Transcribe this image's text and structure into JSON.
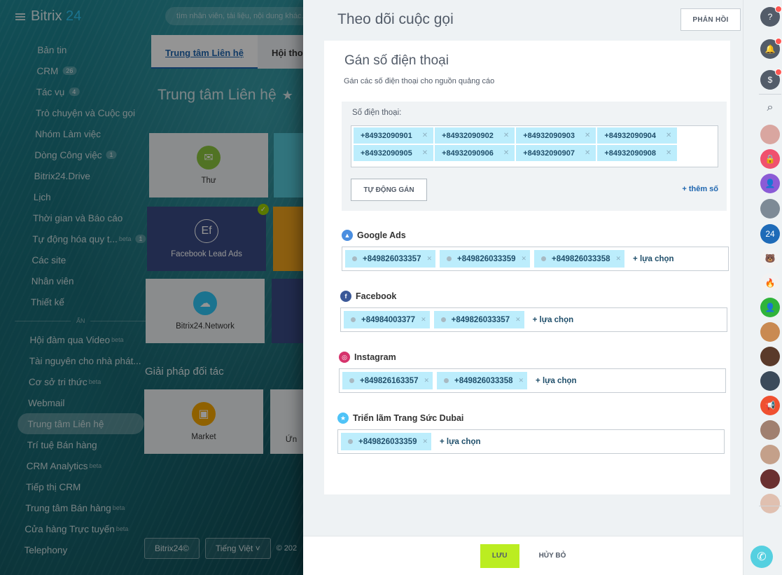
{
  "app": {
    "logo_main": "Bitrix",
    "logo_num": "24",
    "search_placeholder": "tìm nhân viên, tài liệu, nội dung khác..."
  },
  "sidebar": {
    "items": [
      {
        "label": "Bản tin"
      },
      {
        "label": "CRM",
        "count": "26"
      },
      {
        "label": "Tác vụ",
        "count": "4"
      },
      {
        "label": "Trò chuyện và Cuộc gọi"
      },
      {
        "label": "Nhóm Làm việc"
      },
      {
        "label": "Dòng Công việc",
        "count": "1"
      },
      {
        "label": "Bitrix24.Drive"
      },
      {
        "label": "Lịch"
      },
      {
        "label": "Thời gian và Báo cáo"
      },
      {
        "label": "Tự động hóa quy t...",
        "beta": "beta",
        "count": "1"
      },
      {
        "label": "Các site"
      },
      {
        "label": "Nhân viên"
      },
      {
        "label": "Thiết kế"
      }
    ],
    "hidden_label": "ẨN",
    "hidden_items": [
      {
        "label": "Hội đàm qua Video",
        "beta": "beta"
      },
      {
        "label": "Tài nguyên cho nhà phát..."
      },
      {
        "label": "Cơ sở tri thức",
        "beta": "beta"
      },
      {
        "label": "Webmail"
      },
      {
        "label": "Trung tâm Liên hệ",
        "active": true
      },
      {
        "label": "Trí tuệ Bán hàng"
      },
      {
        "label": "CRM Analytics",
        "beta": "beta"
      },
      {
        "label": "Tiếp thị CRM"
      },
      {
        "label": "Trung tâm Bán hàng",
        "beta": "beta"
      },
      {
        "label": "Cửa hàng Trực tuyến",
        "beta": "beta"
      },
      {
        "label": "Telephony"
      }
    ]
  },
  "background_page": {
    "tabs": [
      "Trung tâm Liên hệ",
      "Hội thoại"
    ],
    "title": "Trung tâm Liên hệ",
    "tiles": [
      {
        "label": "Thư",
        "icon": "mail-icon"
      },
      {
        "label": "Facebook Lead Ads",
        "icon": "form-icon"
      },
      {
        "label": "Bitrix24.Network",
        "icon": "cloud-icon"
      }
    ],
    "partner_title": "Giải pháp đối tác",
    "partner_tiles": [
      {
        "label": "Market"
      },
      {
        "label": "Ứn"
      }
    ],
    "footer": {
      "brand": "Bitrix24©",
      "language": "Tiếng Việt",
      "copyright": "© 202"
    }
  },
  "slider": {
    "title": "Theo dõi cuộc gọi",
    "feedback_label": "PHẢN HỒI",
    "card": {
      "title": "Gán số điện thoại",
      "subtitle": "Gán các số điện thoại cho nguồn quảng cáo",
      "phones_label": "Số điện thoại:",
      "phones": [
        "+84932090901",
        "+84932090902",
        "+84932090903",
        "+84932090904",
        "+84932090905",
        "+84932090906",
        "+84932090907",
        "+84932090908"
      ],
      "auto_assign_label": "TỰ ĐỘNG GÁN",
      "add_number_label": "+ thêm số"
    },
    "add_choice_label": "+ lựa chọn",
    "sources": [
      {
        "name": "Google Ads",
        "icon": "google-ads-icon",
        "color": "#4a8ee0",
        "glyph": "▲",
        "numbers": [
          "+849826033357",
          "+849826033359",
          "+849826033358"
        ]
      },
      {
        "name": "Facebook",
        "icon": "facebook-icon",
        "color": "#3b5998",
        "glyph": "f",
        "numbers": [
          "+84984003377",
          "+849826033357"
        ]
      },
      {
        "name": "Instagram",
        "icon": "instagram-icon",
        "color": "#d6336c",
        "glyph": "◎",
        "numbers": [
          "+849826163357",
          "+849826033358"
        ]
      },
      {
        "name": "Triển lãm Trang Sức Dubai",
        "icon": "star-icon",
        "color": "#4fc3f7",
        "glyph": "★",
        "numbers": [
          "+849826033359"
        ]
      }
    ],
    "footer": {
      "save_label": "LƯU",
      "cancel_label": "HỦY BỎ"
    }
  },
  "rail": {
    "items": [
      {
        "icon": "help-icon",
        "glyph": "?",
        "color": "#535c69",
        "badge": true
      },
      {
        "icon": "bell-icon",
        "glyph": "🔔",
        "color": "#535c69",
        "badge": true
      },
      {
        "icon": "chat-count-icon",
        "glyph": "$",
        "color": "#535c69",
        "badge": true
      },
      {
        "icon": "search-icon",
        "glyph": "⌕",
        "color": "transparent"
      },
      {
        "icon": "avatar-icon",
        "glyph": "",
        "color": "#d9a6a0"
      },
      {
        "icon": "lock-icon",
        "glyph": "🔒",
        "color": "#f0506e"
      },
      {
        "icon": "user-icon",
        "glyph": "👤",
        "color": "#8b5bd6"
      },
      {
        "icon": "avatar-icon",
        "glyph": "",
        "color": "#7d8a96"
      },
      {
        "icon": "bitrix24-icon",
        "glyph": "24",
        "color": "#1e6bb8"
      },
      {
        "icon": "mascot-icon",
        "glyph": "🐻",
        "color": "#f2f2f2"
      },
      {
        "icon": "flame-icon",
        "glyph": "🔥",
        "color": "#f2f2f2"
      },
      {
        "icon": "crm-user-icon",
        "glyph": "👤",
        "color": "#2fb43a"
      },
      {
        "icon": "avatar-icon",
        "glyph": "",
        "color": "#c98a52"
      },
      {
        "icon": "avatar-icon",
        "glyph": "",
        "color": "#5a3a2a"
      },
      {
        "icon": "avatar-icon",
        "glyph": "",
        "color": "#3b4a5a"
      },
      {
        "icon": "megaphone-icon",
        "glyph": "📢",
        "color": "#ef5030"
      },
      {
        "icon": "avatar-icon",
        "glyph": "",
        "color": "#a08070"
      },
      {
        "icon": "avatar-icon",
        "glyph": "",
        "color": "#c4a08a"
      },
      {
        "icon": "avatar-icon",
        "glyph": "",
        "color": "#6a3030"
      },
      {
        "icon": "avatar-icon",
        "glyph": "",
        "color": "#e0c0b0"
      }
    ]
  }
}
